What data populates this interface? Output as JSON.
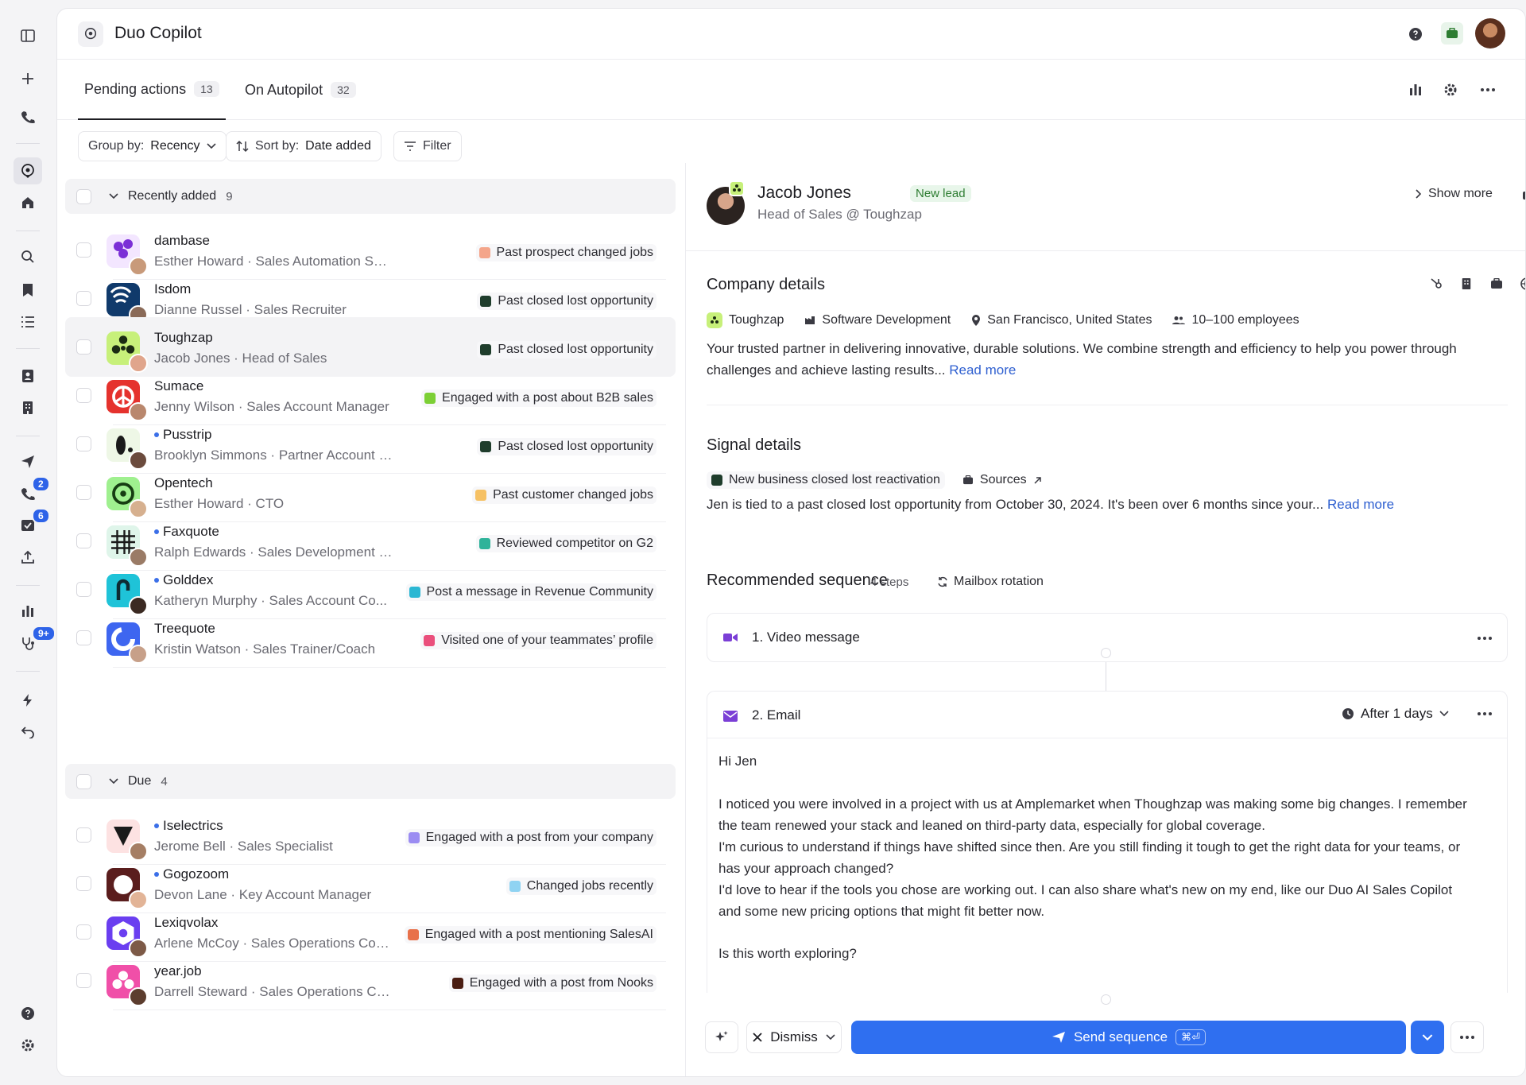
{
  "app": {
    "title": "Duo Copilot"
  },
  "rail": {
    "badges": {
      "phone": "2",
      "tasks": "6",
      "health": "9+"
    }
  },
  "tabs": [
    {
      "label": "Pending actions",
      "count": "13"
    },
    {
      "label": "On Autopilot",
      "count": "32"
    }
  ],
  "toolbar": {
    "group_prefix": "Group by:",
    "group_value": "Recency",
    "sort_prefix": "Sort by:",
    "sort_value": "Date added",
    "filter": "Filter"
  },
  "groups": [
    {
      "label": "Recently added",
      "count": "9"
    },
    {
      "label": "Due",
      "count": "4"
    }
  ],
  "rows": [
    {
      "company": "dambase",
      "person": "Esther Howard · Sales Automation Specialist",
      "tag": "Past prospect changed jobs",
      "tag_color": "#f4a58a",
      "logo_bg": "#f3e6ff",
      "logo_fg": "#7b2fd6"
    },
    {
      "company": "Isdom",
      "person": "Dianne Russel · Sales Recruiter",
      "tag": "Past closed lost opportunity",
      "tag_color": "#1f3d2c",
      "logo_bg": "#103a6b",
      "logo_fg": "#ffffff"
    },
    {
      "company": "Toughzap",
      "person": "Jacob Jones · Head of Sales",
      "tag": "Past closed lost opportunity",
      "tag_color": "#1f3d2c",
      "logo_bg": "#c7f07a",
      "logo_fg": "#1b2b12"
    },
    {
      "company": "Sumace",
      "person": "Jenny Wilson · Sales Account Manager",
      "tag": "Engaged with a post about B2B sales",
      "tag_color": "#7ccf35",
      "logo_bg": "#e5322d",
      "logo_fg": "#ffffff"
    },
    {
      "company": "Pusstrip",
      "person": "Brooklyn Simmons · Partner Account Manager",
      "tag": "Past closed lost opportunity",
      "tag_color": "#1f3d2c",
      "logo_bg": "#eef7e6",
      "logo_fg": "#1a1a1a",
      "dot": true
    },
    {
      "company": "Opentech",
      "person": "Esther Howard · CTO",
      "tag": "Past customer changed jobs",
      "tag_color": "#f6c164",
      "logo_bg": "#9ff08f",
      "logo_fg": "#163d12"
    },
    {
      "company": "Faxquote",
      "person": "Ralph Edwards · Sales Development Manager",
      "tag": "Reviewed competitor on G2",
      "tag_color": "#2fb39a",
      "logo_bg": "#dff5ea",
      "logo_fg": "#1a1a1a",
      "dot": true
    },
    {
      "company": "Golddex",
      "person": "Katheryn Murphy · Sales Account Co...",
      "tag": "Post a message in Revenue Community",
      "tag_color": "#2bb7d3",
      "logo_bg": "#1fc3d8",
      "logo_fg": "#0e2b33",
      "dot": true
    },
    {
      "company": "Treequote",
      "person": "Kristin Watson · Sales Trainer/Coach",
      "tag": "Visited one of your teammates’ profile",
      "tag_color": "#ea4f7c",
      "logo_bg": "#3e66f0",
      "logo_fg": "#ffffff"
    },
    {
      "company": "Iselectrics",
      "person": "Jerome Bell · Sales Specialist",
      "tag": "Engaged with a post from your company",
      "tag_color": "#9b8cf2",
      "logo_bg": "#fde2e2",
      "logo_fg": "#1a1a1a",
      "dot": true
    },
    {
      "company": "Gogozoom",
      "person": "Devon Lane · Key Account Manager",
      "tag": "Changed jobs recently",
      "tag_color": "#8fd3f2",
      "logo_bg": "#5a1d1d",
      "logo_fg": "#ffffff",
      "dot": true
    },
    {
      "company": "Lexiqvolax",
      "person": "Arlene McCoy · Sales Operations Coo...",
      "tag": "Engaged with a post mentioning SalesAI",
      "tag_color": "#e8714a",
      "logo_bg": "#6a3ef0",
      "logo_fg": "#ffffff"
    },
    {
      "company": "year.job",
      "person": "Darrell Steward · Sales Operations Coordina...",
      "tag": "Engaged with a post from Nooks",
      "tag_color": "#4a1d12",
      "logo_bg": "#f04fa8",
      "logo_fg": "#ffffff"
    }
  ],
  "lead": {
    "name": "Jacob Jones",
    "badge": "New lead",
    "title": "Head of Sales @ Toughzap",
    "show_more": "Show more"
  },
  "company": {
    "heading": "Company details",
    "name": "Toughzap",
    "industry": "Software Development",
    "location": "San Francisco, United States",
    "size": "10–100 employees",
    "description": "Your trusted partner in delivering innovative, durable solutions. We combine strength and efficiency to help you power through challenges and achieve lasting results...",
    "read_more": "Read more"
  },
  "signal": {
    "heading": "Signal details",
    "tag": "New business closed lost reactivation",
    "sources": "Sources",
    "text": "Jen is tied to a past closed lost opportunity from October 30, 2024. It's been over 6 months since your...",
    "read_more": "Read more"
  },
  "sequence": {
    "heading": "Recommended sequence",
    "steps_count": "4 steps",
    "rotation": "Mailbox rotation",
    "step1": "1. Video message",
    "step2": "2. Email",
    "delay": "After 1 days",
    "email": {
      "greeting": "Hi Jen",
      "p1": "I noticed you were involved in a project with us at Amplemarket when Thoughzap was making some big changes. I remember the team renewed your stack and leaned on third-party data, especially for global coverage.",
      "p2": "I'm curious to understand if things have shifted since then. Are you still finding it tough to get the right data for your teams, or has your approach changed?",
      "p3": "I'd love to hear if the tools you chose are working out. I can also share what's new on my end, like our Duo AI Sales Copilot and some new pricing options that might fit better now.",
      "p4": "Is this worth exploring?"
    }
  },
  "footer": {
    "dismiss": "Dismiss",
    "send": "Send sequence",
    "shortcut": "⌘⏎"
  },
  "colors": {
    "primary": "#2f6ff0",
    "accent_green": "#2e7d32"
  }
}
